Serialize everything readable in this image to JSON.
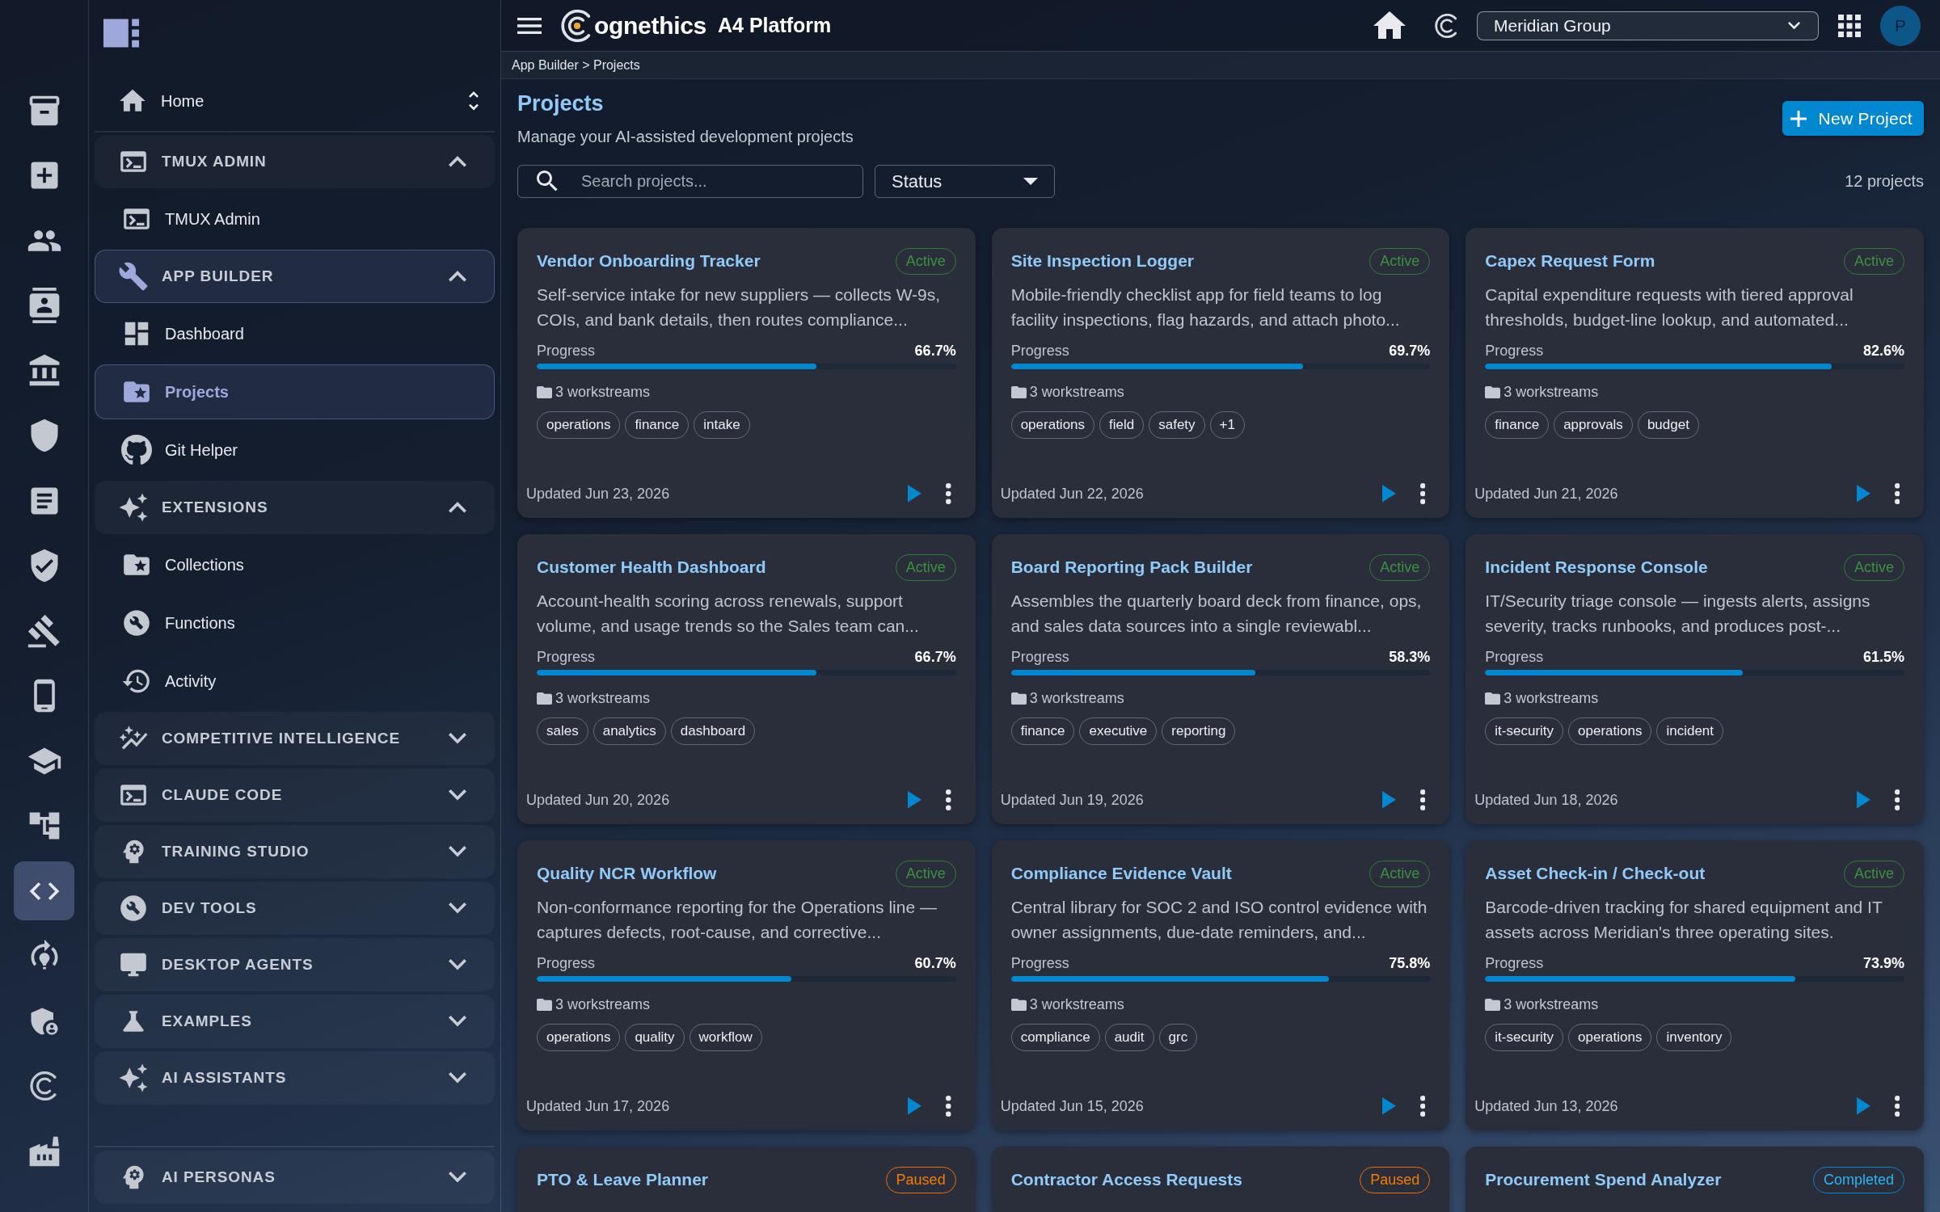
{
  "icon_rail": [
    {
      "selected": false
    },
    {
      "selected": false
    },
    {
      "selected": false
    },
    {
      "selected": false
    },
    {
      "selected": false
    },
    {
      "selected": false
    },
    {
      "selected": false
    },
    {
      "selected": false
    },
    {
      "selected": false
    },
    {
      "selected": false
    },
    {
      "selected": false
    },
    {
      "selected": false
    },
    {
      "selected": true
    },
    {
      "selected": false
    },
    {
      "selected": false
    },
    {
      "selected": false
    },
    {
      "selected": false
    }
  ],
  "sidebar": {
    "home": {
      "label": "Home",
      "selected": false
    },
    "groups": [
      {
        "label": "TMUX ADMIN",
        "expanded": true,
        "selected": false,
        "children": [
          {
            "label": "TMUX Admin",
            "selected": false
          }
        ]
      },
      {
        "label": "APP BUILDER",
        "expanded": true,
        "selected": true,
        "children": [
          {
            "label": "Dashboard",
            "selected": false
          },
          {
            "label": "Projects",
            "selected": true
          },
          {
            "label": "Git Helper",
            "selected": false
          }
        ]
      },
      {
        "label": "EXTENSIONS",
        "expanded": true,
        "selected": false,
        "children": [
          {
            "label": "Collections",
            "selected": false
          },
          {
            "label": "Functions",
            "selected": false
          },
          {
            "label": "Activity",
            "selected": false
          }
        ]
      },
      {
        "label": "COMPETITIVE INTELLIGENCE",
        "expanded": false,
        "selected": false
      },
      {
        "label": "CLAUDE CODE",
        "expanded": false,
        "selected": false
      },
      {
        "label": "TRAINING STUDIO",
        "expanded": false,
        "selected": false
      },
      {
        "label": "DEV TOOLS",
        "expanded": false,
        "selected": false
      },
      {
        "label": "DESKTOP AGENTS",
        "expanded": false,
        "selected": false
      },
      {
        "label": "EXAMPLES",
        "expanded": false,
        "selected": false
      },
      {
        "label": "AI ASSISTANTS",
        "expanded": false,
        "selected": false
      }
    ],
    "footer_group": {
      "label": "AI PERSONAS",
      "expanded": false,
      "selected": false
    }
  },
  "top_bar": {
    "brand_text": "ognethics",
    "product": "A4 Platform",
    "organization_select": {
      "value": "Meridian Group"
    },
    "avatar": "P"
  },
  "breadcrumb": "App Builder > Projects",
  "page": {
    "title": "Projects",
    "subtitle": "Manage your AI-assisted development projects",
    "new_button": "New Project",
    "search": {
      "placeholder": "Search projects..."
    },
    "status_filter": {
      "label": "Status"
    },
    "count": "12 projects"
  },
  "projects": [
    {
      "title": "Vendor Onboarding Tracker",
      "status": {
        "label": "Active",
        "kind": "active"
      },
      "description": "Self-service intake for new suppliers — collects W-9s, COIs, and bank details, then routes compliance...",
      "progress": {
        "label": "Progress",
        "reading": "66.7%",
        "level": 0.667
      },
      "workstreams": "3 workstreams",
      "tags": [
        "operations",
        "finance",
        "intake"
      ],
      "updated": "Updated Jun 23, 2026"
    },
    {
      "title": "Site Inspection Logger",
      "status": {
        "label": "Active",
        "kind": "active"
      },
      "description": "Mobile-friendly checklist app for field teams to log facility inspections, flag hazards, and attach photo...",
      "progress": {
        "label": "Progress",
        "reading": "69.7%",
        "level": 0.697
      },
      "workstreams": "3 workstreams",
      "tags": [
        "operations",
        "field",
        "safety",
        "+1"
      ],
      "updated": "Updated Jun 22, 2026"
    },
    {
      "title": "Capex Request Form",
      "status": {
        "label": "Active",
        "kind": "active"
      },
      "description": "Capital expenditure requests with tiered approval thresholds, budget-line lookup, and automated...",
      "progress": {
        "label": "Progress",
        "reading": "82.6%",
        "level": 0.826
      },
      "workstreams": "3 workstreams",
      "tags": [
        "finance",
        "approvals",
        "budget"
      ],
      "updated": "Updated Jun 21, 2026"
    },
    {
      "title": "Customer Health Dashboard",
      "status": {
        "label": "Active",
        "kind": "active"
      },
      "description": "Account-health scoring across renewals, support volume, and usage trends so the Sales team can...",
      "progress": {
        "label": "Progress",
        "reading": "66.7%",
        "level": 0.667
      },
      "workstreams": "3 workstreams",
      "tags": [
        "sales",
        "analytics",
        "dashboard"
      ],
      "updated": "Updated Jun 20, 2026"
    },
    {
      "title": "Board Reporting Pack Builder",
      "status": {
        "label": "Active",
        "kind": "active"
      },
      "description": "Assembles the quarterly board deck from finance, ops, and sales data sources into a single reviewabl...",
      "progress": {
        "label": "Progress",
        "reading": "58.3%",
        "level": 0.583
      },
      "workstreams": "3 workstreams",
      "tags": [
        "finance",
        "executive",
        "reporting"
      ],
      "updated": "Updated Jun 19, 2026"
    },
    {
      "title": "Incident Response Console",
      "status": {
        "label": "Active",
        "kind": "active"
      },
      "description": "IT/Security triage console — ingests alerts, assigns severity, tracks runbooks, and produces post-...",
      "progress": {
        "label": "Progress",
        "reading": "61.5%",
        "level": 0.615
      },
      "workstreams": "3 workstreams",
      "tags": [
        "it-security",
        "operations",
        "incident"
      ],
      "updated": "Updated Jun 18, 2026"
    },
    {
      "title": "Quality NCR Workflow",
      "status": {
        "label": "Active",
        "kind": "active"
      },
      "description": "Non-conformance reporting for the Operations line — captures defects, root-cause, and corrective...",
      "progress": {
        "label": "Progress",
        "reading": "60.7%",
        "level": 0.607
      },
      "workstreams": "3 workstreams",
      "tags": [
        "operations",
        "quality",
        "workflow"
      ],
      "updated": "Updated Jun 17, 2026"
    },
    {
      "title": "Compliance Evidence Vault",
      "status": {
        "label": "Active",
        "kind": "active"
      },
      "description": "Central library for SOC 2 and ISO control evidence with owner assignments, due-date reminders, and...",
      "progress": {
        "label": "Progress",
        "reading": "75.8%",
        "level": 0.758
      },
      "workstreams": "3 workstreams",
      "tags": [
        "compliance",
        "audit",
        "grc"
      ],
      "updated": "Updated Jun 15, 2026"
    },
    {
      "title": "Asset Check-in / Check-out",
      "status": {
        "label": "Active",
        "kind": "active"
      },
      "description": "Barcode-driven tracking for shared equipment and IT assets across Meridian's three operating sites.",
      "progress": {
        "label": "Progress",
        "reading": "73.9%",
        "level": 0.739
      },
      "workstreams": "3 workstreams",
      "tags": [
        "it-security",
        "operations",
        "inventory"
      ],
      "updated": "Updated Jun 13, 2026"
    },
    {
      "title": "PTO & Leave Planner",
      "status": {
        "label": "Paused",
        "kind": "paused"
      }
    },
    {
      "title": "Contractor Access Requests",
      "status": {
        "label": "Paused",
        "kind": "paused"
      }
    },
    {
      "title": "Procurement Spend Analyzer",
      "status": {
        "label": "Completed",
        "kind": "completed"
      }
    }
  ]
}
